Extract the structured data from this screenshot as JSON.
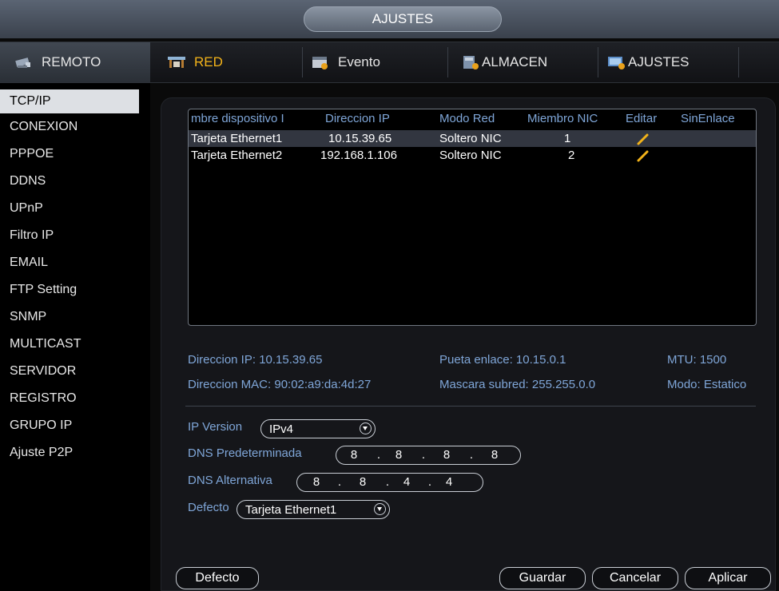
{
  "window": {
    "title": "AJUSTES"
  },
  "tabs": [
    {
      "label": "REMOTO",
      "icon": "remote-icon"
    },
    {
      "label": "RED",
      "icon": "network-icon",
      "selected": true
    },
    {
      "label": "Evento",
      "icon": "event-icon"
    },
    {
      "label": "ALMACEN",
      "icon": "storage-icon"
    },
    {
      "label": "AJUSTES",
      "icon": "settings-icon"
    }
  ],
  "sidebar": {
    "items": [
      {
        "label": "TCP/IP",
        "selected": true
      },
      {
        "label": "CONEXION"
      },
      {
        "label": "PPPOE"
      },
      {
        "label": "DDNS"
      },
      {
        "label": "UPnP"
      },
      {
        "label": "Filtro IP"
      },
      {
        "label": "EMAIL"
      },
      {
        "label": "FTP Setting"
      },
      {
        "label": "SNMP"
      },
      {
        "label": "MULTICAST"
      },
      {
        "label": "SERVIDOR"
      },
      {
        "label": "REGISTRO"
      },
      {
        "label": "GRUPO IP"
      },
      {
        "label": "Ajuste P2P"
      }
    ]
  },
  "table": {
    "headers": [
      "mbre dispositivo I",
      "Direccion IP",
      "Modo Red",
      "Miembro NIC",
      "Editar",
      "SinEnlace"
    ],
    "rows": [
      {
        "device": "Tarjeta Ethernet1",
        "ip": "10.15.39.65",
        "mode": "Soltero NIC",
        "member": "1",
        "selected": true
      },
      {
        "device": "Tarjeta Ethernet2",
        "ip": "192.168.1.106",
        "mode": "Soltero NIC",
        "member": "2"
      }
    ]
  },
  "info": {
    "ip": "Direccion IP: 10.15.39.65",
    "gateway": "Pueta enlace: 10.15.0.1",
    "mtu": "MTU: 1500",
    "mac": "Direccion MAC: 90:02:a9:da:4d:27",
    "mask": "Mascara subred: 255.255.0.0",
    "mode": "Modo: Estatico"
  },
  "form": {
    "ip_version_label": "IP Version",
    "ip_version_value": "IPv4",
    "dns_primary_label": "DNS Predeterminada",
    "dns_primary": [
      "8",
      "8",
      "8",
      "8"
    ],
    "dns_alt_label": "DNS Alternativa",
    "dns_alt": [
      "8",
      "8",
      "4",
      "4"
    ],
    "default_label": "Defecto",
    "default_value": "Tarjeta Ethernet1"
  },
  "buttons": {
    "default": "Defecto",
    "save": "Guardar",
    "cancel": "Cancelar",
    "apply": "Aplicar"
  },
  "colors": {
    "accent_selected_tab": "#f3b319",
    "label_blue": "#7fa6d8",
    "edit_pencil": "#f3b319"
  }
}
